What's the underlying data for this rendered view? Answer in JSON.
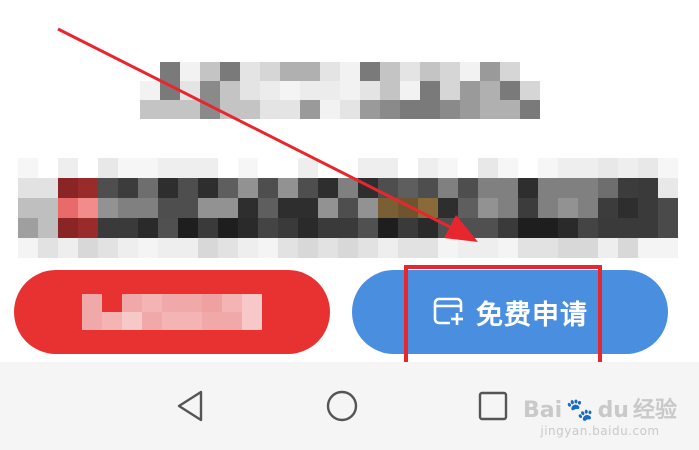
{
  "buttons": {
    "left": {
      "label": "",
      "color": "#e83232"
    },
    "right": {
      "label": "免费申请",
      "icon": "card-add-icon",
      "color": "#4a8ee0"
    }
  },
  "annotations": {
    "arrow_color": "#e8262e",
    "highlight_color": "#e8262e"
  },
  "nav_bar": {
    "items": [
      {
        "name": "back",
        "icon": "triangle-back-icon"
      },
      {
        "name": "home",
        "icon": "circle-home-icon"
      },
      {
        "name": "recent",
        "icon": "square-recent-icon"
      }
    ]
  },
  "watermark": {
    "brand": "Bai",
    "brand_suffix": "du",
    "product": "经验",
    "url": "jingyan.baidu.com"
  }
}
